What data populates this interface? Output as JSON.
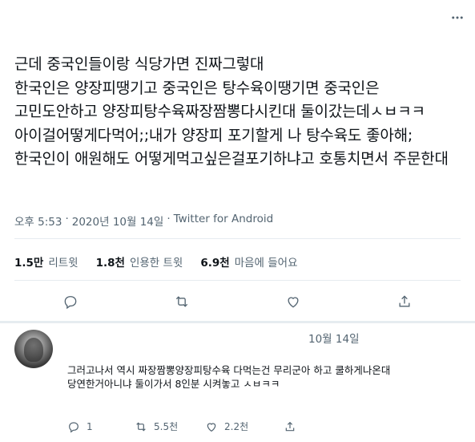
{
  "tweet": {
    "text": "근데 중국인들이랑 식당가면 진짜그렇대\n한국인은 양장피땡기고 중국인은 탕수육이땡기면 중국인은 고민도안하고 양장피탕수육짜장짬뽕다시킨대 둘이갔는데ㅅㅂㅋㅋ 아이걸어떻게다먹어;;내가 양장피 포기할게 나 탕수육도 좋아해;한국인이 애원해도 어떻게먹고싶은걸포기하냐고 호통치면서 주문한대",
    "time": "오후 5:53",
    "sep1": "·",
    "date": "2020년 10월 14일",
    "sep2": "·",
    "source": "Twitter for Android"
  },
  "stats": {
    "retweets_value": "1.5만",
    "retweets_label": "리트윗",
    "quotes_value": "1.8천",
    "quotes_label": "인용한 트윗",
    "likes_value": "6.9천",
    "likes_label": "마음에 들어요"
  },
  "reply": {
    "date": "10월 14일",
    "text": "그러고나서 역시 짜장짬뽕양장피탕수육 다먹는건 무리군아 하고 쿨하게나온대\n당연한거아니냐 둘이가서 8인분 시켜놓고 ㅅㅂㅋㅋ",
    "replies": "1",
    "retweets": "5.5천",
    "likes": "2.2천"
  },
  "icons": {
    "more": "more-horizontal-icon",
    "reply": "reply-bubble-icon",
    "retweet": "retweet-icon",
    "like": "heart-icon",
    "share": "share-icon"
  },
  "colors": {
    "text": "#0f1419",
    "muted": "#536471",
    "border": "#e6ecf0"
  }
}
